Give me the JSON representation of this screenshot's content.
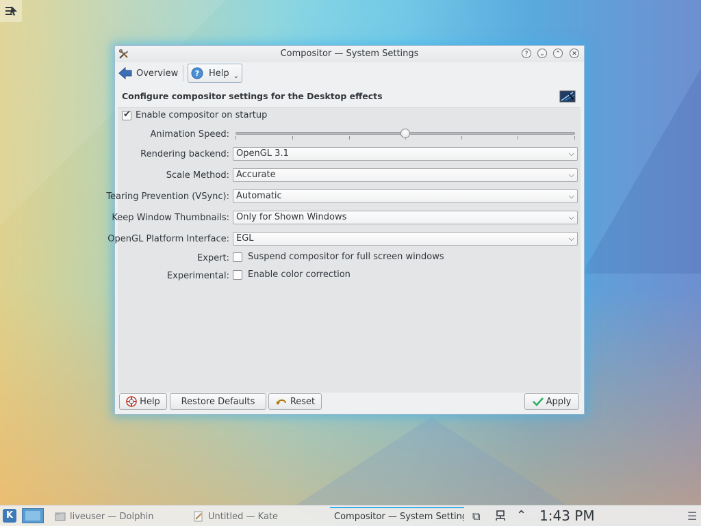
{
  "window": {
    "title": "Compositor — System Settings",
    "buttons": {
      "help": "?",
      "minimize": "⌄",
      "maximize": "⌃",
      "close": "✕"
    }
  },
  "toolbar": {
    "overview_label": "Overview",
    "help_label": "Help",
    "help_dropdown": "⌄"
  },
  "content": {
    "header": "Configure compositor settings for the Desktop effects",
    "enable_compositor": {
      "label": "Enable compositor on startup",
      "checked": true
    },
    "animation_speed": {
      "label": "Animation Speed:",
      "value_fraction": 0.5
    },
    "rendering_backend": {
      "label": "Rendering backend:",
      "value": "OpenGL 3.1"
    },
    "scale_method": {
      "label": "Scale Method:",
      "value": "Accurate"
    },
    "tearing_prevention": {
      "label": "Tearing Prevention (VSync):",
      "value": "Automatic"
    },
    "keep_thumbnails": {
      "label": "Keep Window Thumbnails:",
      "value": "Only for Shown Windows"
    },
    "opengl_platform": {
      "label": "OpenGL Platform Interface:",
      "value": "EGL"
    },
    "expert": {
      "label": "Expert:",
      "option": "Suspend compositor for full screen windows",
      "checked": false
    },
    "experimental": {
      "label": "Experimental:",
      "option": "Enable color correction",
      "checked": false
    }
  },
  "buttons": {
    "help": "Help",
    "restore_defaults": "Restore Defaults",
    "reset": "Reset",
    "apply": "Apply"
  },
  "taskbar": {
    "kicker_letter": "K",
    "tasks": [
      {
        "label": "liveuser — Dolphin"
      },
      {
        "label": "Untitled  — Kate"
      },
      {
        "label": "Compositor — System Settings"
      }
    ],
    "clock": "1:43 PM"
  },
  "colors": {
    "accent": "#3daee9",
    "window_bg": "#eff0f1",
    "text": "#31363b"
  }
}
